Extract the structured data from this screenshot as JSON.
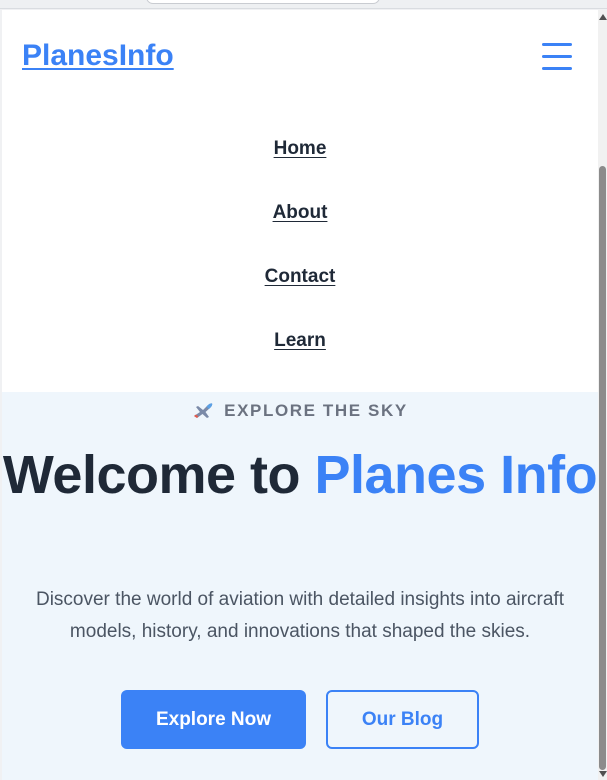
{
  "header": {
    "logo_text": "PlanesInfo",
    "menu_icon": "hamburger-menu-icon"
  },
  "nav": {
    "items": [
      {
        "label": "Home"
      },
      {
        "label": "About"
      },
      {
        "label": "Contact"
      },
      {
        "label": "Learn"
      }
    ]
  },
  "hero": {
    "eyebrow_icon": "airplane-icon",
    "eyebrow": "EXPLORE THE SKY",
    "title_prefix": "Welcome to ",
    "title_accent": "Planes Info",
    "description": "Discover the world of aviation with detailed insights into aircraft models, history, and innovations that shaped the skies.",
    "primary_button": "Explore Now",
    "secondary_button": "Our Blog"
  },
  "colors": {
    "accent": "#3b82f6",
    "heading": "#1f2937",
    "muted": "#6b7280",
    "hero_background": "#eff6fc"
  }
}
